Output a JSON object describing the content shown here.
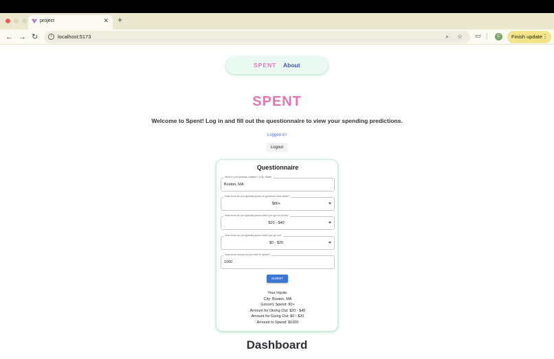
{
  "browser": {
    "tab_title": "project",
    "url": "localhost:5173",
    "finish_update_label": "Finish update",
    "avatar_initial": "C",
    "new_tab_glyph": "+",
    "close_glyph": "✕"
  },
  "nav": {
    "brand_label": "SPENT",
    "about_label": "About"
  },
  "main": {
    "title": "SPENT",
    "welcome": "Welcome to Spent! Log in and fill out the questionnaire to view your spending predictions.",
    "logged_in": "Logged in!",
    "logout_label": "Logout"
  },
  "questionnaire": {
    "title": "Questionnaire",
    "fields": [
      {
        "label": "What is your primary location? (City, State)",
        "value": "Boston, MA",
        "type": "text"
      },
      {
        "label": "How much do you typically spend on groceries each week?",
        "value": "$80+",
        "type": "select"
      },
      {
        "label": "How much do you typically spend when you go out to eat?",
        "value": "$20 - $40",
        "type": "select"
      },
      {
        "label": "How much do you typically spend when you go out?",
        "value": "$0 - $20",
        "type": "select"
      },
      {
        "label": "How much money do you have to spend?",
        "value": "1000",
        "type": "text"
      }
    ],
    "submit_label": "SUBMIT",
    "summary": {
      "heading": "Your Inputs:",
      "city": "City: Boston, MA",
      "grocery": "Grocery Spend: 80+",
      "dining": "Amount for Dining Out: $20 - $40",
      "going_out": "Amount for Going Out: $0 - $20",
      "to_spend": "Amount to Spend: $1000"
    }
  },
  "dashboard": {
    "title": "Dashboard"
  },
  "colors": {
    "brand_pink": "#e873b4",
    "about_blue": "#3f51b5",
    "submit_blue": "#3a76d2",
    "card_glow": "#cfe9d8",
    "update_yellow": "#f3e58a"
  }
}
